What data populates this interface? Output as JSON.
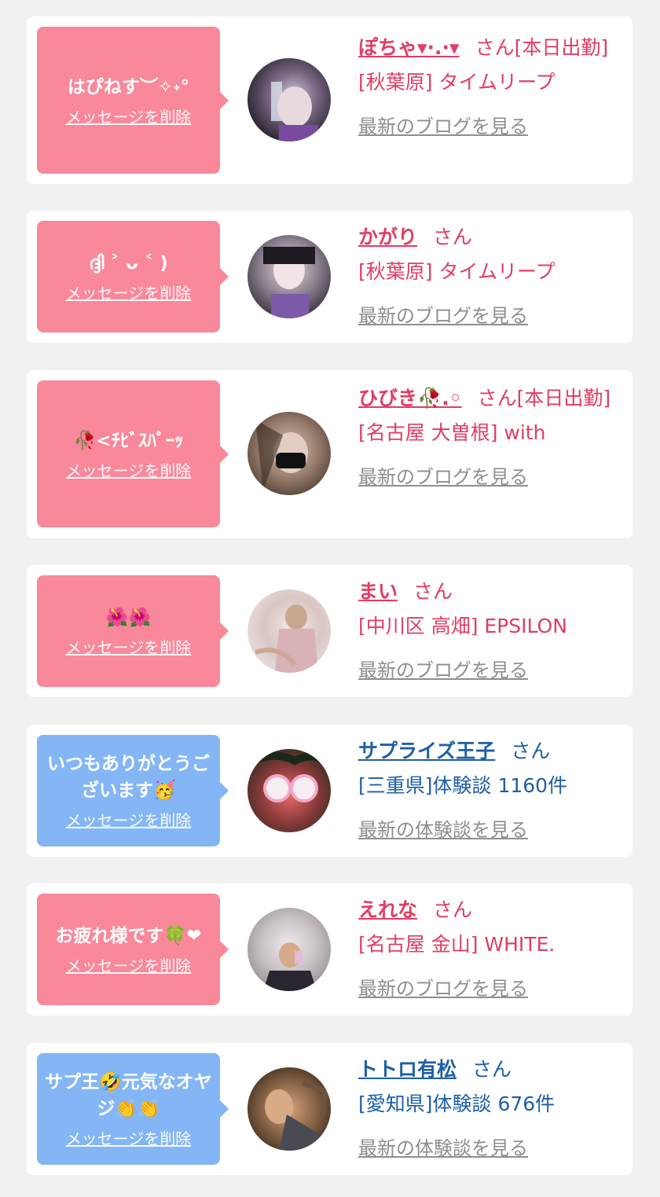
{
  "cards": [
    {
      "message": "はぴねす︶✧˖°",
      "delete_label": "メッセージを削除",
      "name": "ぽちゃ▾·.·▾",
      "suffix": "さん[本日出勤]",
      "shop": "[秋葉原] タイムリープ",
      "link": "最新のブログを見る",
      "type": "pink"
    },
    {
      "message": "ദ്ദി ˃ ᴗ ˂ )",
      "delete_label": "メッセージを削除",
      "name": "かがり",
      "suffix": "さん",
      "shop": "[秋葉原] タイムリープ",
      "link": "最新のブログを見る",
      "type": "pink"
    },
    {
      "message": "🥀<ﾁﾋﾞｽﾊﾟｰｯ",
      "delete_label": "メッセージを削除",
      "name": "ひびき🥀.◦",
      "suffix": "さん[本日出勤]",
      "shop": "[名古屋 大曽根] with",
      "link": "最新のブログを見る",
      "type": "pink"
    },
    {
      "message": "🌺🌺",
      "delete_label": "メッセージを削除",
      "name": "まい",
      "suffix": "さん",
      "shop": "[中川区 高畑] EPSILON",
      "link": "最新のブログを見る",
      "type": "pink"
    },
    {
      "message": "いつもありがとうございます🥳",
      "delete_label": "メッセージを削除",
      "name": "サプライズ王子",
      "suffix": "さん",
      "shop": "[三重県]体験談 1160件",
      "link": "最新の体験談を見る",
      "type": "blue"
    },
    {
      "message": "お疲れ様です🍀❤",
      "delete_label": "メッセージを削除",
      "name": "えれな",
      "suffix": "さん",
      "shop": "[名古屋 金山] WHITE.",
      "link": "最新のブログを見る",
      "type": "pink"
    },
    {
      "message": "サプ王🤣元気なオヤジ👏👏",
      "delete_label": "メッセージを削除",
      "name": "トトロ有松",
      "suffix": "さん",
      "shop": "[愛知県]体験談 676件",
      "link": "最新の体験談を見る",
      "type": "blue"
    }
  ],
  "colors": {
    "pink_bubble": "#f9889a",
    "blue_bubble": "#84b6f5",
    "pink_text": "#e23c63",
    "blue_text": "#1e5ea9"
  }
}
